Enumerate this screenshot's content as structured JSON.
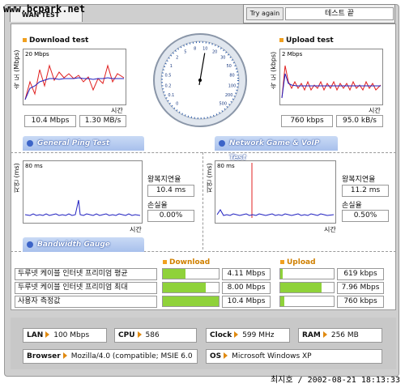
{
  "watermark": "www.bcpark.net",
  "wan_tab": "WAN TEST",
  "try_again_label": "Try again",
  "status": "테스트 끝",
  "download": {
    "title": "Download test",
    "ylabel": "속 도 (Mbps)",
    "scale": "20 Mbps",
    "xlabel": "시간",
    "speed_mbps": "10.4 Mbps",
    "speed_mbs": "1.30 MB/s"
  },
  "upload": {
    "title": "Upload test",
    "ylabel": "속 도 (kbps)",
    "scale": "2 Mbps",
    "xlabel": "시간",
    "speed_kbps": "760 kbps",
    "speed_kbs": "95.0 kB/s"
  },
  "gauge": {
    "ticks": [
      "0",
      "0.1",
      "0.2",
      "0.5",
      "1",
      "2",
      "5",
      "8",
      "10",
      "20",
      "30",
      "50",
      "80",
      "100",
      "200",
      "500"
    ],
    "needle_value": 10.4
  },
  "ping": {
    "tab": "General Ping Test",
    "ylabel": "지연 (ms)",
    "scale": "80 ms",
    "xlabel": "시간",
    "rtt_label": "왕복지연율",
    "rtt_value": "10.4 ms",
    "loss_label": "손실율",
    "loss_value": "0.00%"
  },
  "game": {
    "tab": "Network Game & VoIP Test",
    "ylabel": "지연 (ms)",
    "scale": "80 ms",
    "xlabel": "시간",
    "rtt_label": "왕복지연율",
    "rtt_value": "11.2 ms",
    "loss_label": "손실율",
    "loss_value": "0.50%"
  },
  "bandwidth": {
    "tab": "Bandwidth Gauge",
    "download_header": "Download",
    "upload_header": "Upload",
    "rows": [
      {
        "label": "두루넷 케이블 인터넷 프리미엄 평균",
        "download": "4.11 Mbps",
        "download_frac": 0.4,
        "upload": "619 kbps",
        "upload_frac": 0.05
      },
      {
        "label": "두루넷 케이블 인터넷 프리미엄 최대",
        "download": "8.00 Mbps",
        "download_frac": 0.77,
        "upload": "7.96 Mbps",
        "upload_frac": 0.78
      },
      {
        "label": "사용자 측정값",
        "download": "10.4 Mbps",
        "download_frac": 1.0,
        "upload": "760 kbps",
        "upload_frac": 0.07
      }
    ]
  },
  "system": {
    "lan_key": "LAN",
    "lan_val": "100 Mbps",
    "cpu_key": "CPU",
    "cpu_val": "586",
    "clock_key": "Clock",
    "clock_val": "599 MHz",
    "ram_key": "RAM",
    "ram_val": "256 MB",
    "browser_key": "Browser",
    "browser_val": "Mozilla/4.0 (compatible; MSIE 6.0",
    "os_key": "OS",
    "os_val": "Microsoft Windows XP"
  },
  "footer": "최지호 / 2002-08-21 18:13:33",
  "colors": {
    "accent": "#f0a020",
    "bar": "#8fd23a",
    "tab": "#a8c0ec",
    "series_red": "#e02020",
    "series_blue": "#2020c0"
  }
}
